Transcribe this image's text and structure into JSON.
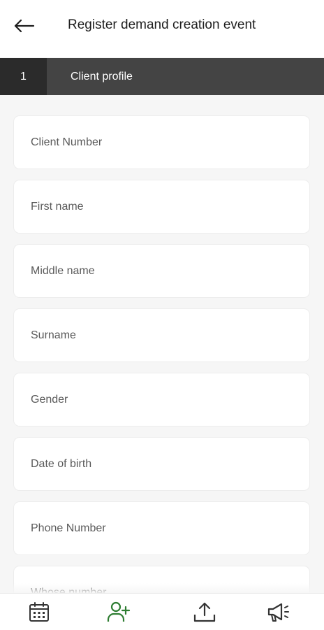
{
  "header": {
    "title": "Register demand creation event",
    "back_icon": "arrow-left-icon"
  },
  "stepper": {
    "step_number": "1",
    "step_title": "Client profile"
  },
  "form": {
    "fields": [
      {
        "placeholder": "Client Number"
      },
      {
        "placeholder": "First name"
      },
      {
        "placeholder": "Middle name"
      },
      {
        "placeholder": "Surname"
      },
      {
        "placeholder": "Gender"
      },
      {
        "placeholder": "Date of birth"
      },
      {
        "placeholder": "Phone Number"
      },
      {
        "placeholder": "Whose number"
      }
    ]
  },
  "bottom_nav": {
    "items": [
      {
        "icon": "calendar-icon",
        "active": false
      },
      {
        "icon": "add-user-icon",
        "active": true
      },
      {
        "icon": "upload-icon",
        "active": false
      },
      {
        "icon": "megaphone-icon",
        "active": false
      }
    ],
    "active_color": "#2e7d32",
    "inactive_color": "#333333"
  },
  "colors": {
    "step_bar": "#444444",
    "step_number_bg": "#2b2b2b",
    "page_background": "#f6f6f6"
  }
}
